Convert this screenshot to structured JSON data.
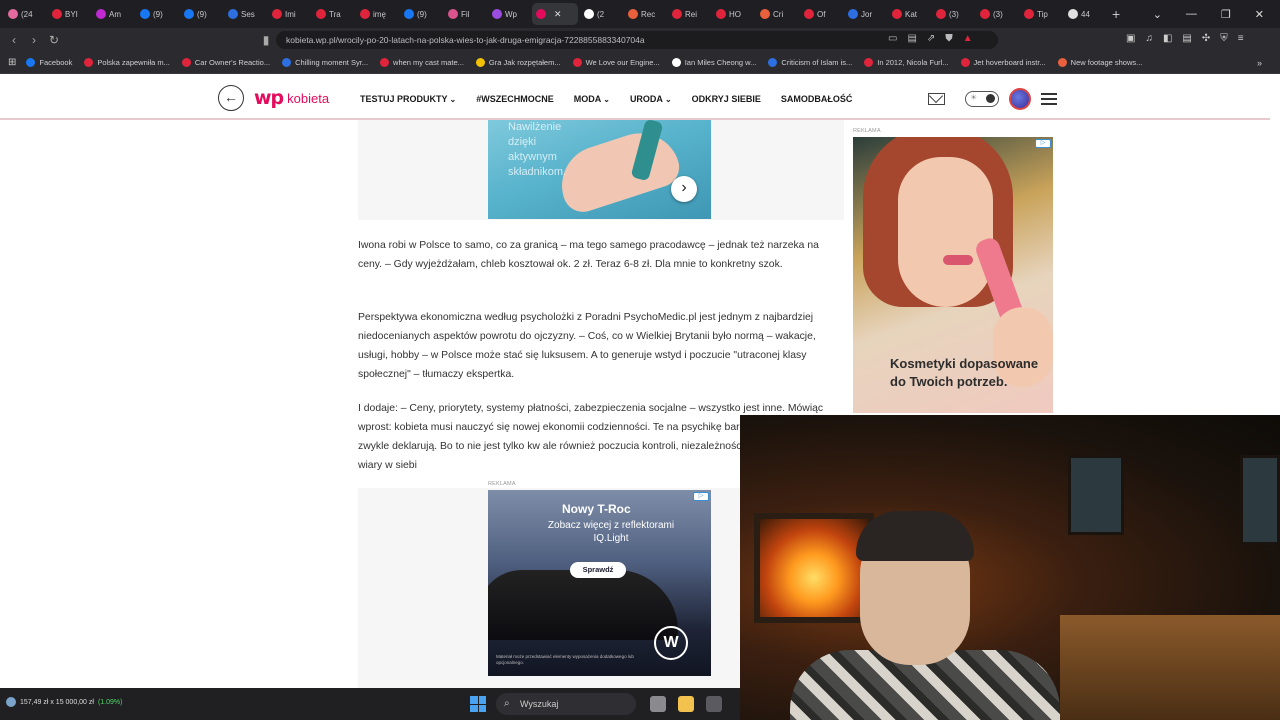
{
  "browser": {
    "tabs": [
      {
        "label": "(24",
        "color": "#e36a9e"
      },
      {
        "label": "BYI",
        "color": "#e0243b"
      },
      {
        "label": "Am",
        "color": "#c02ad1"
      },
      {
        "label": "(9)",
        "color": "#1877f2"
      },
      {
        "label": "(9)",
        "color": "#1877f2"
      },
      {
        "label": "Ses",
        "color": "#2d6ee0"
      },
      {
        "label": "Imi",
        "color": "#e0243b"
      },
      {
        "label": "Tra",
        "color": "#e0243b"
      },
      {
        "label": "imę",
        "color": "#e0243b"
      },
      {
        "label": "(9)",
        "color": "#1877f2"
      },
      {
        "label": "Fil",
        "color": "#d9548c"
      },
      {
        "label": "Wp",
        "color": "#9b4de0"
      },
      {
        "label": "",
        "color": "#e30b5c",
        "active": true
      },
      {
        "label": "(2",
        "color": "#ffffff"
      },
      {
        "label": "Rec",
        "color": "#e8603c"
      },
      {
        "label": "Rei",
        "color": "#e0243b"
      },
      {
        "label": "HO",
        "color": "#e0243b"
      },
      {
        "label": "Cri",
        "color": "#e8603c"
      },
      {
        "label": "Of",
        "color": "#e0243b"
      },
      {
        "label": "Jor",
        "color": "#2d6ee0"
      },
      {
        "label": "Kat",
        "color": "#e0243b"
      },
      {
        "label": "(3)",
        "color": "#e0243b"
      },
      {
        "label": "(3)",
        "color": "#e0243b"
      },
      {
        "label": "Tip",
        "color": "#e0243b"
      },
      {
        "label": "44",
        "color": "#e0e0e0"
      }
    ],
    "url": "kobieta.wp.pl/wrocily-po-20-latach-na-polska-wies-to-jak-druga-emigracja-7228855883340704a",
    "bookmarks": [
      {
        "label": "Facebook",
        "color": "#1877f2"
      },
      {
        "label": "Polska zapewniła m...",
        "color": "#e0243b"
      },
      {
        "label": "Car Owner's Reactio...",
        "color": "#e0243b"
      },
      {
        "label": "Chilling moment Syr...",
        "color": "#2d6ee0"
      },
      {
        "label": "when my cast mate...",
        "color": "#e0243b"
      },
      {
        "label": "Gra Jak rozpętałem...",
        "color": "#f2c200"
      },
      {
        "label": "We Love our Engine...",
        "color": "#e0243b"
      },
      {
        "label": "Ian Miles Cheong w...",
        "color": "#ffffff"
      },
      {
        "label": "Criticism of Islam is...",
        "color": "#2d6ee0"
      },
      {
        "label": "In 2012, Nicola Furl...",
        "color": "#e0243b"
      },
      {
        "label": "Jet hoverboard instr...",
        "color": "#e0243b"
      },
      {
        "label": "New footage shows...",
        "color": "#e8603c"
      }
    ]
  },
  "site": {
    "logo_mark": "wp",
    "logo_text": "kobieta",
    "nav": [
      {
        "label": "TESTUJ PRODUKTY",
        "dropdown": true
      },
      {
        "label": "#WSZECHMOCNE",
        "dropdown": false
      },
      {
        "label": "MODA",
        "dropdown": true
      },
      {
        "label": "URODA",
        "dropdown": true
      },
      {
        "label": "ODKRYJ SIEBIE",
        "dropdown": false
      },
      {
        "label": "SAMODBAŁOŚĆ",
        "dropdown": false
      }
    ],
    "accent": "#e30b5c"
  },
  "article": {
    "ad_top_text": "Nawilżenie dzięki aktywnym składnikom.",
    "p1": "Iwona robi w Polsce to samo, co za granicą – ma tego samego pracodawcę – jednak też narzeka na ceny. – Gdy wyjeżdżałam, chleb kosztował ok. 2 zł. Teraz 6-8 zł. Dla mnie to konkretny szok.",
    "p2": "Perspektywa ekonomiczna według psycholożki z Poradni PsychoMedic.pl jest jednym z najbardziej niedocenianych aspektów powrotu do ojczyzny. – Coś, co w Wielkiej Brytanii było normą – wakacje, usługi, hobby – w Polsce może stać się luksusem. A to generuje wstyd i poczucie \"utraconej klasy społecznej\" – tłumaczy ekspertka.",
    "p3": "I dodaje: – Ceny, priorytety, systemy płatności, zabezpieczenia socjalne – wszystko jest inne. Mówiąc wprost: kobieta musi nauczyć się nowej ekonomii codzienności. Te na psychikę bardziej, niż te kobiety zwykle deklarują. Bo to nie jest tylko kw ale również poczucia kontroli, niezależności, bezpieczeństwa, wiary w siebi",
    "ad_label": "REKLAMA",
    "vw_ad": {
      "title": "Nowy T-Roc",
      "subtitle": "Zobacz więcej z reflektorami IQ.Light",
      "button": "Sprawdź",
      "fine_print": "Materiał może przedstawiać elementy wyposażenia dodatkowego lub opcjonalnego."
    }
  },
  "sidebar_ad": {
    "label": "REKLAMA",
    "copy": "Kosmetyki dopasowane do Twoich potrzeb."
  },
  "taskbar": {
    "ticker": "157,49 zł x 15 000,00 zł",
    "ticker_pct": "(1.09%)",
    "search_placeholder": "Wyszukaj"
  }
}
